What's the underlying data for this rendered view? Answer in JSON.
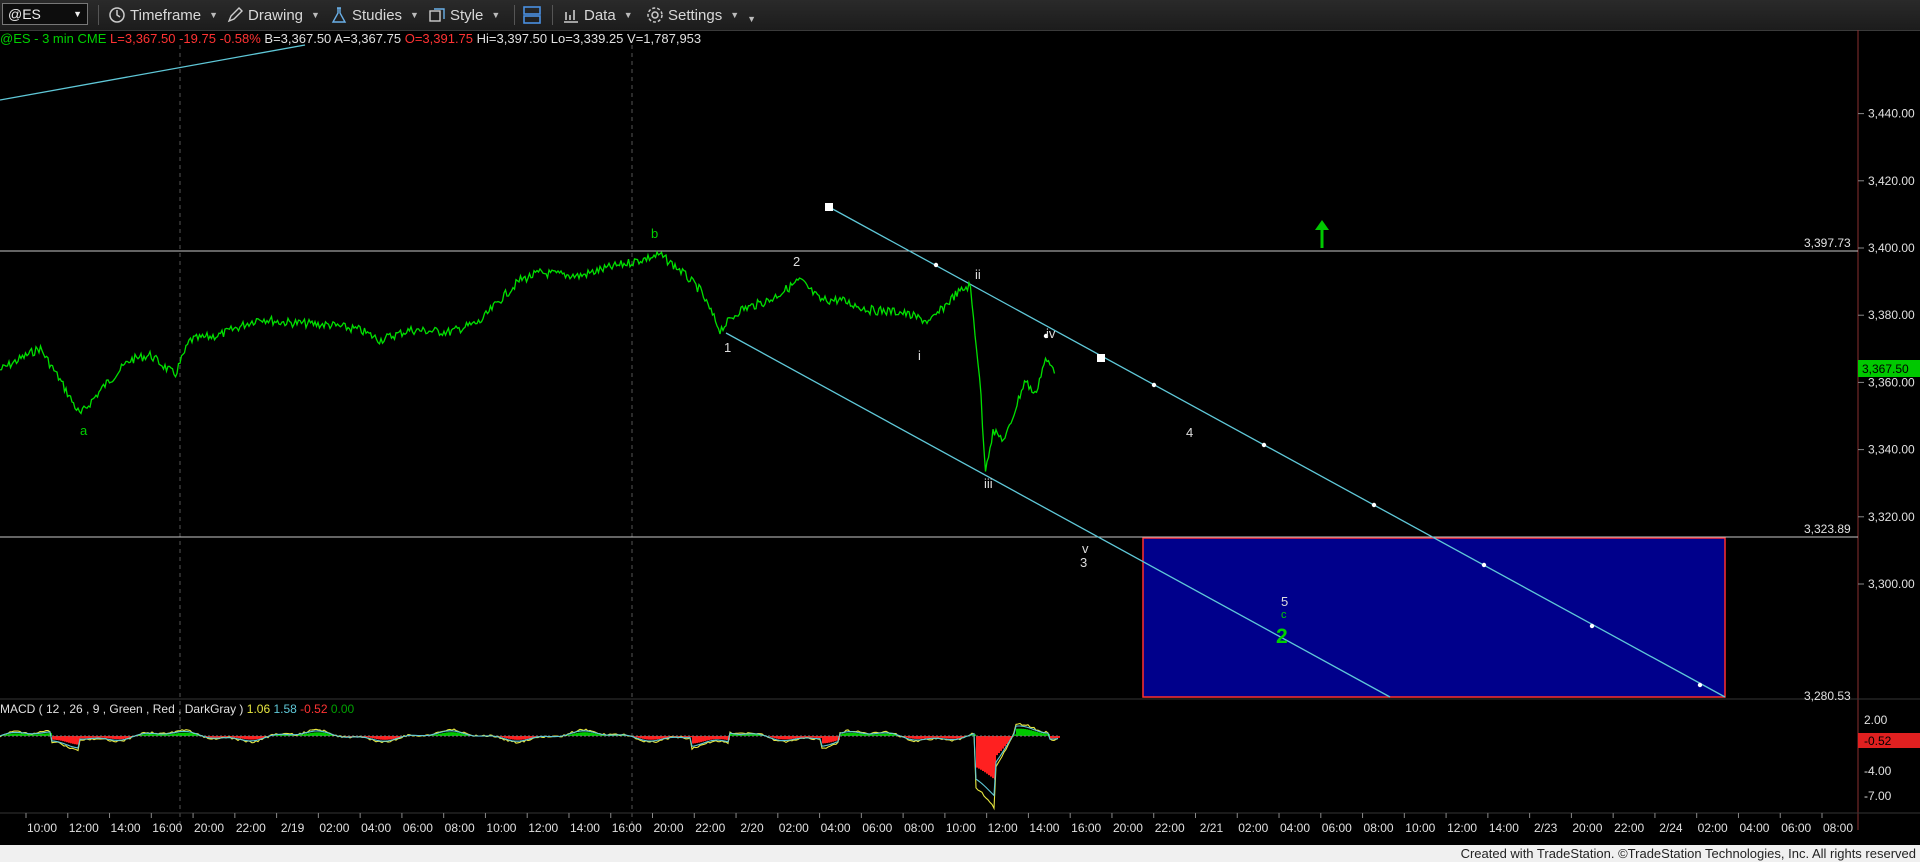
{
  "toolbar": {
    "symbol": "@ES",
    "timeframe": "Timeframe",
    "drawing": "Drawing",
    "studies": "Studies",
    "style": "Style",
    "data": "Data",
    "settings": "Settings"
  },
  "header": {
    "symbol": "@ES - 3 min",
    "exchange": "CME",
    "last": "L=3,367.50",
    "change": "-19.75",
    "change_pct": "-0.58%",
    "bid": "B=3,367.50",
    "ask": "A=3,367.75",
    "open": "O=3,391.75",
    "high": "Hi=3,397.50",
    "low": "Lo=3,339.25",
    "volume": "V=1,787,953"
  },
  "macd": {
    "label": "MACD ( 12 , 26 , 9 , Green , Red , DarkGray )",
    "v1": "1.06",
    "v2": "1.58",
    "v3": "-0.52",
    "v4": "0.00"
  },
  "price_axis": {
    "ticks": [
      "3,440.00",
      "3,420.00",
      "3,400.00",
      "3,380.00",
      "3,360.00",
      "3,340.00",
      "3,320.00",
      "3,300.00"
    ],
    "tick_values": [
      3440,
      3420,
      3400,
      3380,
      3360,
      3340,
      3320,
      3300
    ],
    "last_price": "3,367.50",
    "hline_upper": "3,397.73",
    "hline_lower": "3,323.89",
    "box_bottom": "3,280.53"
  },
  "macd_axis": {
    "ticks": [
      "2.00",
      "-0.52",
      "-4.00",
      "-7.00"
    ]
  },
  "time_axis": {
    "labels": [
      "10:00",
      "12:00",
      "14:00",
      "16:00",
      "20:00",
      "22:00",
      "2/19",
      "02:00",
      "04:00",
      "06:00",
      "08:00",
      "10:00",
      "12:00",
      "14:00",
      "16:00",
      "20:00",
      "22:00",
      "2/20",
      "02:00",
      "04:00",
      "06:00",
      "08:00",
      "10:00",
      "12:00",
      "14:00",
      "16:00",
      "20:00",
      "22:00",
      "2/21",
      "02:00",
      "04:00",
      "06:00",
      "08:00",
      "10:00",
      "12:00",
      "14:00",
      "2/23",
      "20:00",
      "22:00",
      "2/24",
      "02:00",
      "04:00",
      "06:00",
      "08:00"
    ]
  },
  "wave_labels": {
    "a": "a",
    "b": "b",
    "w1": "1",
    "w2": "2",
    "i": "i",
    "ii": "ii",
    "iii": "iii",
    "iv": "iv",
    "v": "v",
    "w3": "3",
    "w4": "4",
    "w5": "5",
    "c": "c",
    "big2": "2"
  },
  "colors": {
    "price_line": "#00e000",
    "channel": "#5fc8d8",
    "target_box": "#00008b",
    "box_border": "#ff3030",
    "macd_hist_pos": "#00c800",
    "macd_hist_neg": "#ff2020",
    "macd_line": "#e8e840",
    "signal_line": "#5fc8d8",
    "arrow": "#00c800"
  },
  "footer": {
    "credit": "Created with TradeStation. ©TradeStation Technologies, Inc. All rights reserved"
  }
}
